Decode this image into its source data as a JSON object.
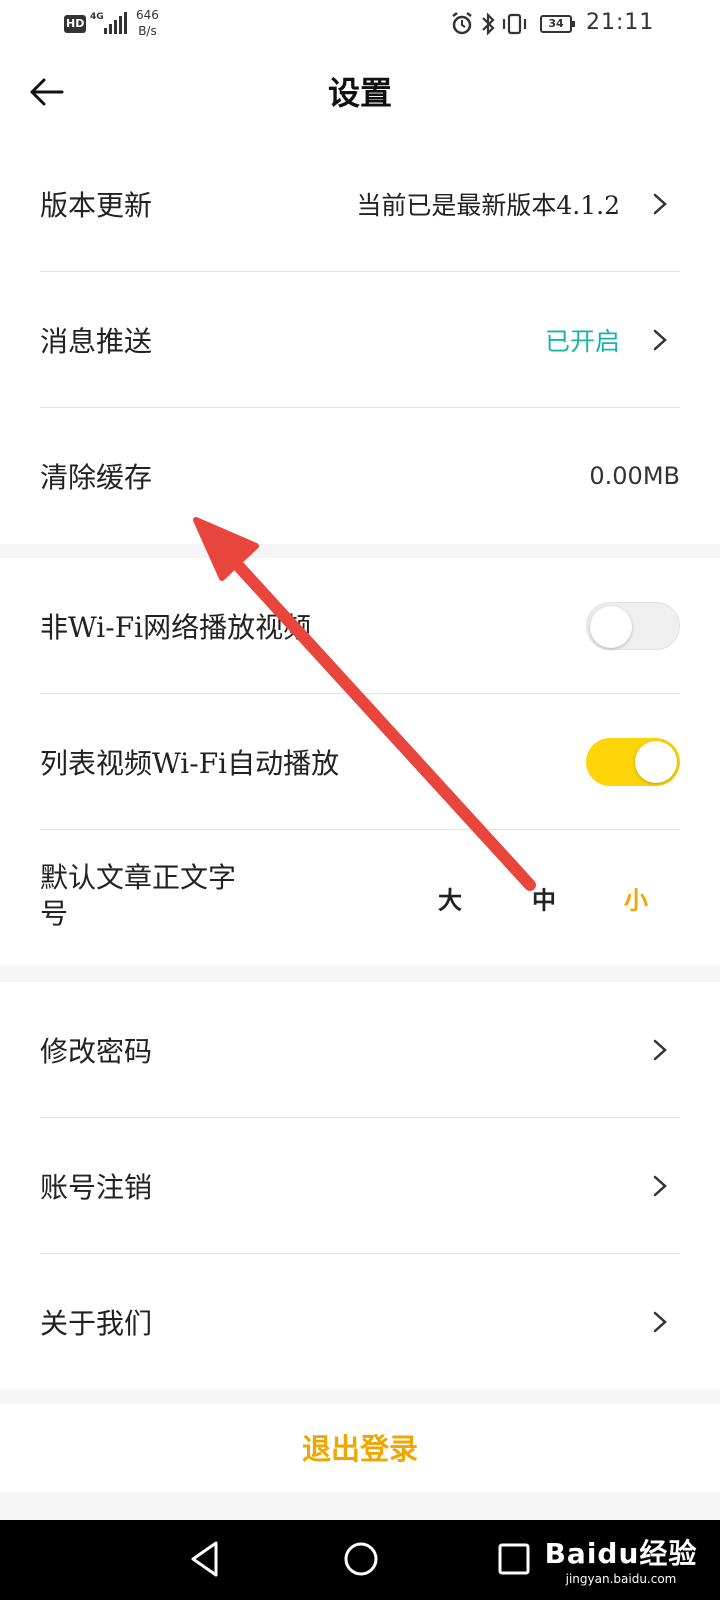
{
  "status_bar": {
    "hd": "HD",
    "network": "4G",
    "speed_value": "646",
    "speed_unit": "B/s",
    "battery": "34",
    "time": "21:11",
    "icons": [
      "alarm-icon",
      "bluetooth-icon",
      "vibrate-icon"
    ]
  },
  "header": {
    "title": "设置",
    "back_icon": "arrow-left-icon"
  },
  "settings": {
    "version_update": {
      "label": "版本更新",
      "value": "当前已是最新版本4.1.2"
    },
    "push": {
      "label": "消息推送",
      "value": "已开启",
      "value_color": "#1bb3a8"
    },
    "clear_cache": {
      "label": "清除缓存",
      "value": "0.00MB"
    },
    "non_wifi_play": {
      "label": "非Wi-Fi网络播放视频",
      "enabled": false
    },
    "list_autoplay": {
      "label": "列表视频Wi-Fi自动播放",
      "enabled": true
    },
    "font_size": {
      "label_line1": "默认文章正文字",
      "label_line2": "号",
      "options": [
        "大",
        "中",
        "小"
      ],
      "selected": "小"
    },
    "change_password": {
      "label": "修改密码"
    },
    "account_cancel": {
      "label": "账号注销"
    },
    "about": {
      "label": "关于我们"
    }
  },
  "logout": {
    "label": "退出登录"
  },
  "colors": {
    "accent": "#f0a500",
    "toggle_on": "#fcd408",
    "teal": "#1bb3a8",
    "annotation_arrow": "#e8453c"
  },
  "watermark": {
    "logo": "Baidu经验",
    "url": "jingyan.baidu.com"
  }
}
